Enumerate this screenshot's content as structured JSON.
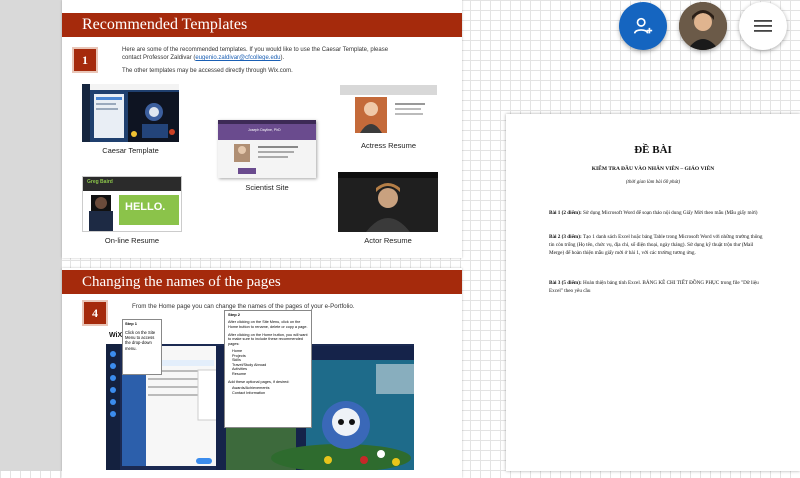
{
  "slide1": {
    "title": "Recommended Templates",
    "number": "1",
    "intro_line1": "Here are some of the recommended templates. If you would like to use the Caesar Template, please",
    "intro_line2_prefix": "contact Professor Zaldivar (",
    "email": "eugenio.zaldivar@cfcollege.edu",
    "intro_line2_suffix": ").",
    "other_note": "The other templates may be accessed directly through Wix.com.",
    "captions": {
      "caesar": "Caesar Template",
      "scientist": "Scientist Site",
      "actress": "Actress Resume",
      "online": "On-line Resume",
      "actor": "Actor Resume"
    },
    "thumb_text": {
      "online_name": "Greg Baird",
      "online_hello": "HELLO.",
      "scientist_name": "Joseph Dayline, PhD"
    }
  },
  "slide2": {
    "title": "Changing the names of the pages",
    "number": "4",
    "intro": "From the Home page you can change the names of the pages of your e-Portfolio.",
    "step1_title": "Step 1",
    "step1_text": "Click on the Site Menu to access the drop-down menu.",
    "step2_title": "Step 2",
    "step2_text1": "After clicking on the Site Menu, click on the Home button to rename, delete or copy a page.",
    "step2_text2": "After clicking on the Home button, you will want to make sure to include these recommended pages:",
    "pages": [
      "Home",
      "Projects",
      "Skills",
      "Travel/Study Abroad",
      "Activities",
      "Resume"
    ],
    "step2_text3": "Add these optional pages, if desired:",
    "optional_pages": [
      "Awards/Achievements",
      "Contact Information"
    ],
    "wix_logo": "WiX"
  },
  "doc": {
    "title": "ĐỀ BÀI",
    "subtitle": "KIỂM TRA ĐẦU VÀO NHÂN VIÊN – GIÁO VIÊN",
    "time_note": "(thời gian làm bài 60 phút)",
    "q1_label": "Bài 1 (2 điểm):",
    "q1_text": "Sử dụng Microsoft Word để soạn thảo nội dung Giấy Mời theo mẫu (Mẫu giấy mời)",
    "q2_label": "Bài 2 (3 điểm):",
    "q2_text": "Tạo 1 danh sách Excel hoặc bảng Table trong Microsoft Word với những trường thông tin còn trống (Họ tên, chức vụ, địa chỉ, số điện thoại, ngày tháng). Sử dụng kỹ thuật trộn thư (Mail Merge) để hoàn thiện mẫu giấy mời ở bài 1, với các trường tương ứng.",
    "q3_label": "Bài 3 (5 điểm):",
    "q3_text": "Hoàn thiện bảng tính Excel. BẢNG KÊ CHI TIẾT ĐỒNG PHỤC trong file \"Dữ liệu Excel\" theo yêu cầu"
  },
  "colors": {
    "band": "#a52a0c",
    "fab_blue": "#1565c0"
  },
  "icons": {
    "add_user": "add-user-icon",
    "menu": "hamburger-menu-icon"
  }
}
